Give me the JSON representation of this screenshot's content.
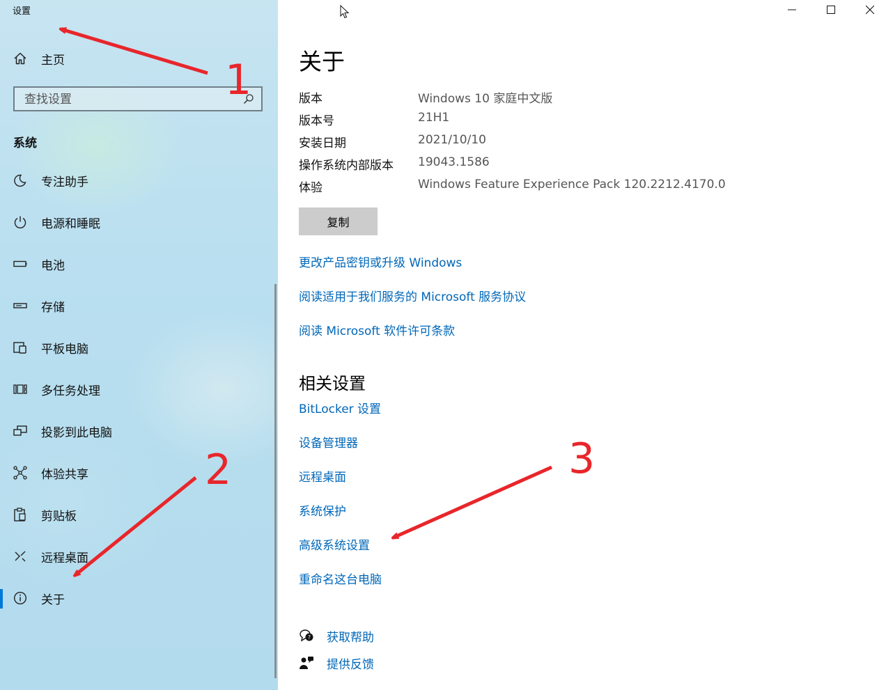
{
  "app": {
    "title": "设置"
  },
  "sidebar": {
    "home_label": "主页",
    "search_placeholder": "查找设置",
    "section": "系统",
    "items": [
      {
        "label": "专注助手",
        "icon": "moon-icon"
      },
      {
        "label": "电源和睡眠",
        "icon": "power-icon"
      },
      {
        "label": "电池",
        "icon": "battery-icon"
      },
      {
        "label": "存储",
        "icon": "storage-icon"
      },
      {
        "label": "平板电脑",
        "icon": "tablet-icon"
      },
      {
        "label": "多任务处理",
        "icon": "multitask-icon"
      },
      {
        "label": "投影到此电脑",
        "icon": "project-icon"
      },
      {
        "label": "体验共享",
        "icon": "share-icon"
      },
      {
        "label": "剪贴板",
        "icon": "clipboard-icon"
      },
      {
        "label": "远程桌面",
        "icon": "remote-desktop-icon"
      },
      {
        "label": "关于",
        "icon": "info-icon",
        "active": true
      }
    ]
  },
  "main": {
    "title": "关于",
    "specs": [
      {
        "key": "版本",
        "value": "Windows 10 家庭中文版"
      },
      {
        "key": "版本号",
        "value": "21H1"
      },
      {
        "key": "安装日期",
        "value": "2021/10/10"
      },
      {
        "key": "操作系统内部版本",
        "value": "19043.1586"
      },
      {
        "key": "体验",
        "value": "Windows Feature Experience Pack 120.2212.4170.0"
      }
    ],
    "copy_label": "复制",
    "links": [
      "更改产品密钥或升级 Windows",
      "阅读适用于我们服务的 Microsoft 服务协议",
      "阅读 Microsoft 软件许可条款"
    ],
    "related_title": "相关设置",
    "related_links": [
      "BitLocker 设置",
      "设备管理器",
      "远程桌面",
      "系统保护",
      "高级系统设置",
      "重命名这台电脑"
    ],
    "help": [
      {
        "label": "获取帮助",
        "icon": "help-chat-icon"
      },
      {
        "label": "提供反馈",
        "icon": "feedback-icon"
      }
    ]
  },
  "annotations": {
    "n1": "1",
    "n2": "2",
    "n3": "3",
    "color": "#e8262b"
  },
  "colors": {
    "accent": "#0078d7",
    "link": "#0067b8"
  }
}
